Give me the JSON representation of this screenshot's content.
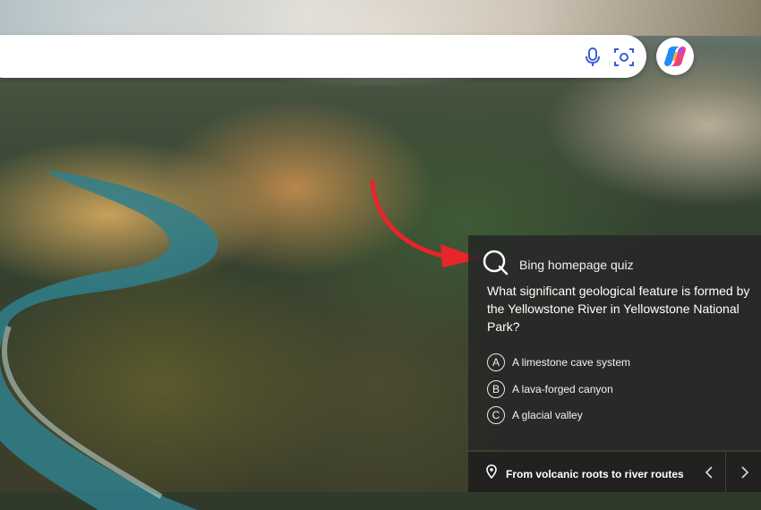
{
  "search": {
    "value": "",
    "placeholder": ""
  },
  "icons": {
    "microphone": "microphone-icon",
    "visual_search": "visual-search-icon",
    "copilot": "copilot-icon",
    "quiz": "quiz-q-icon",
    "location": "location-pin-icon",
    "previous": "chevron-left-icon",
    "next": "chevron-right-icon"
  },
  "quiz": {
    "title": "Bing homepage quiz",
    "question": "What significant geological feature is formed by the Yellowstone River in Yellowstone National Park?",
    "options": [
      {
        "letter": "A",
        "text": "A limestone cave system"
      },
      {
        "letter": "B",
        "text": "A lava-forged canyon"
      },
      {
        "letter": "C",
        "text": "A glacial valley"
      }
    ]
  },
  "caption": {
    "text": "From volcanic roots to river routes"
  },
  "colors": {
    "annotation_arrow": "#e5262a",
    "panel_bg": "#262626",
    "accent_mic": "#4a6df0"
  }
}
